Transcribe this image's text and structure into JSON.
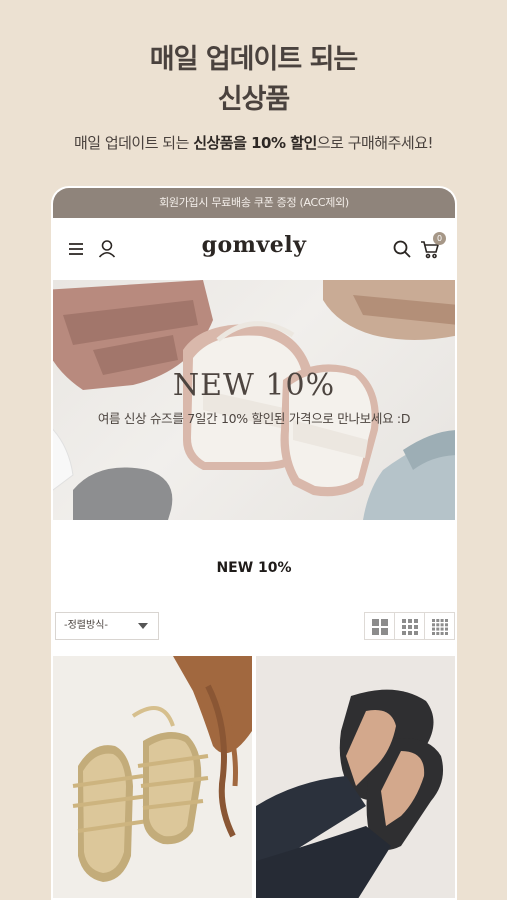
{
  "promo": {
    "title_line1": "매일 업데이트 되는",
    "title_line2": "신상품",
    "subtitle_pre": "매일 업데이트 되는 ",
    "subtitle_bold": "신상품을 10% 할인",
    "subtitle_post": "으로 구매해주세요!"
  },
  "notice": {
    "text": "회원가입시 무료배송 쿠폰 증정 (ACC제외)"
  },
  "header": {
    "logo": "gomvely",
    "cart_count": "0",
    "icons": [
      "menu-icon",
      "user-icon",
      "search-icon",
      "cart-icon"
    ]
  },
  "banner": {
    "title": "NEW 10%",
    "subtitle": "여름 신상 슈즈를 7일간 10% 할인된 가격으로 만나보세요 :D"
  },
  "section": {
    "title": "NEW 10%"
  },
  "sort": {
    "selected": "-정렬방식-"
  },
  "view_options": [
    "grid-2-icon",
    "grid-3-icon",
    "grid-4-icon"
  ],
  "colors": {
    "background": "#ece1d2",
    "notice_bar": "#8f847b",
    "badge": "#a69787"
  }
}
